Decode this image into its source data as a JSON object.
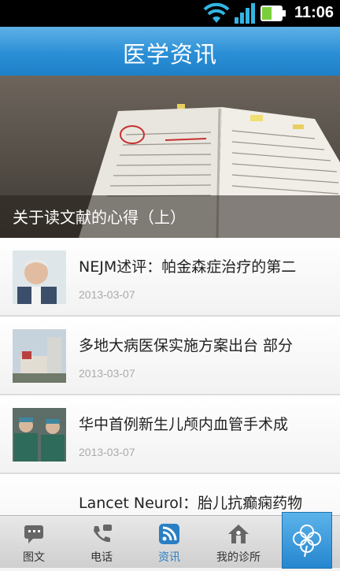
{
  "status_bar": {
    "time": "11:06",
    "icons": [
      "wifi-icon",
      "signal-icon",
      "battery-icon"
    ]
  },
  "header": {
    "title": "医学资讯"
  },
  "banner": {
    "caption": "关于读文献的心得（上）"
  },
  "news": [
    {
      "title": "NEJM述评：帕金森症治疗的第二",
      "date": "2013-03-07",
      "thumb": "elderly-man-photo"
    },
    {
      "title": "多地大病医保实施方案出台 部分",
      "date": "2013-03-07",
      "thumb": "hospital-building-photo"
    },
    {
      "title": "华中首例新生儿颅内血管手术成",
      "date": "2013-03-07",
      "thumb": "surgeons-photo"
    },
    {
      "title": "Lancet Neurol：胎儿抗癫痫药物",
      "date": "",
      "thumb": ""
    }
  ],
  "tabs": [
    {
      "label": "图文",
      "icon": "chat-icon"
    },
    {
      "label": "电话",
      "icon": "phone-icon"
    },
    {
      "label": "资讯",
      "icon": "rss-icon",
      "active": true
    },
    {
      "label": "我的诊所",
      "icon": "home-icon"
    }
  ],
  "colors": {
    "accent": "#2a8fd6",
    "active_tab": "#2a7fc4"
  }
}
